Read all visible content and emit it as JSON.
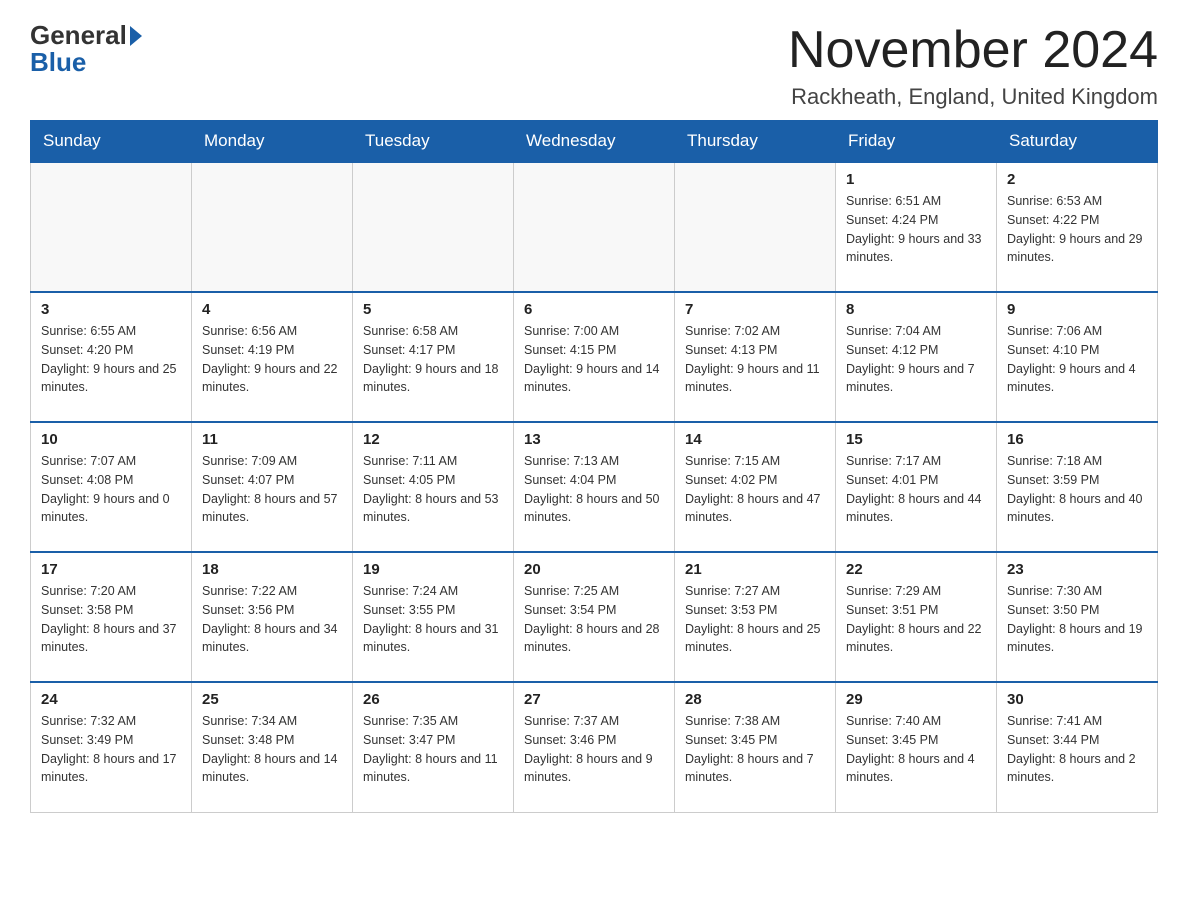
{
  "logo": {
    "general": "General",
    "blue": "Blue"
  },
  "header": {
    "title": "November 2024",
    "location": "Rackheath, England, United Kingdom"
  },
  "days_of_week": [
    "Sunday",
    "Monday",
    "Tuesday",
    "Wednesday",
    "Thursday",
    "Friday",
    "Saturday"
  ],
  "weeks": [
    [
      {
        "day": "",
        "info": ""
      },
      {
        "day": "",
        "info": ""
      },
      {
        "day": "",
        "info": ""
      },
      {
        "day": "",
        "info": ""
      },
      {
        "day": "",
        "info": ""
      },
      {
        "day": "1",
        "info": "Sunrise: 6:51 AM\nSunset: 4:24 PM\nDaylight: 9 hours and 33 minutes."
      },
      {
        "day": "2",
        "info": "Sunrise: 6:53 AM\nSunset: 4:22 PM\nDaylight: 9 hours and 29 minutes."
      }
    ],
    [
      {
        "day": "3",
        "info": "Sunrise: 6:55 AM\nSunset: 4:20 PM\nDaylight: 9 hours and 25 minutes."
      },
      {
        "day": "4",
        "info": "Sunrise: 6:56 AM\nSunset: 4:19 PM\nDaylight: 9 hours and 22 minutes."
      },
      {
        "day": "5",
        "info": "Sunrise: 6:58 AM\nSunset: 4:17 PM\nDaylight: 9 hours and 18 minutes."
      },
      {
        "day": "6",
        "info": "Sunrise: 7:00 AM\nSunset: 4:15 PM\nDaylight: 9 hours and 14 minutes."
      },
      {
        "day": "7",
        "info": "Sunrise: 7:02 AM\nSunset: 4:13 PM\nDaylight: 9 hours and 11 minutes."
      },
      {
        "day": "8",
        "info": "Sunrise: 7:04 AM\nSunset: 4:12 PM\nDaylight: 9 hours and 7 minutes."
      },
      {
        "day": "9",
        "info": "Sunrise: 7:06 AM\nSunset: 4:10 PM\nDaylight: 9 hours and 4 minutes."
      }
    ],
    [
      {
        "day": "10",
        "info": "Sunrise: 7:07 AM\nSunset: 4:08 PM\nDaylight: 9 hours and 0 minutes."
      },
      {
        "day": "11",
        "info": "Sunrise: 7:09 AM\nSunset: 4:07 PM\nDaylight: 8 hours and 57 minutes."
      },
      {
        "day": "12",
        "info": "Sunrise: 7:11 AM\nSunset: 4:05 PM\nDaylight: 8 hours and 53 minutes."
      },
      {
        "day": "13",
        "info": "Sunrise: 7:13 AM\nSunset: 4:04 PM\nDaylight: 8 hours and 50 minutes."
      },
      {
        "day": "14",
        "info": "Sunrise: 7:15 AM\nSunset: 4:02 PM\nDaylight: 8 hours and 47 minutes."
      },
      {
        "day": "15",
        "info": "Sunrise: 7:17 AM\nSunset: 4:01 PM\nDaylight: 8 hours and 44 minutes."
      },
      {
        "day": "16",
        "info": "Sunrise: 7:18 AM\nSunset: 3:59 PM\nDaylight: 8 hours and 40 minutes."
      }
    ],
    [
      {
        "day": "17",
        "info": "Sunrise: 7:20 AM\nSunset: 3:58 PM\nDaylight: 8 hours and 37 minutes."
      },
      {
        "day": "18",
        "info": "Sunrise: 7:22 AM\nSunset: 3:56 PM\nDaylight: 8 hours and 34 minutes."
      },
      {
        "day": "19",
        "info": "Sunrise: 7:24 AM\nSunset: 3:55 PM\nDaylight: 8 hours and 31 minutes."
      },
      {
        "day": "20",
        "info": "Sunrise: 7:25 AM\nSunset: 3:54 PM\nDaylight: 8 hours and 28 minutes."
      },
      {
        "day": "21",
        "info": "Sunrise: 7:27 AM\nSunset: 3:53 PM\nDaylight: 8 hours and 25 minutes."
      },
      {
        "day": "22",
        "info": "Sunrise: 7:29 AM\nSunset: 3:51 PM\nDaylight: 8 hours and 22 minutes."
      },
      {
        "day": "23",
        "info": "Sunrise: 7:30 AM\nSunset: 3:50 PM\nDaylight: 8 hours and 19 minutes."
      }
    ],
    [
      {
        "day": "24",
        "info": "Sunrise: 7:32 AM\nSunset: 3:49 PM\nDaylight: 8 hours and 17 minutes."
      },
      {
        "day": "25",
        "info": "Sunrise: 7:34 AM\nSunset: 3:48 PM\nDaylight: 8 hours and 14 minutes."
      },
      {
        "day": "26",
        "info": "Sunrise: 7:35 AM\nSunset: 3:47 PM\nDaylight: 8 hours and 11 minutes."
      },
      {
        "day": "27",
        "info": "Sunrise: 7:37 AM\nSunset: 3:46 PM\nDaylight: 8 hours and 9 minutes."
      },
      {
        "day": "28",
        "info": "Sunrise: 7:38 AM\nSunset: 3:45 PM\nDaylight: 8 hours and 7 minutes."
      },
      {
        "day": "29",
        "info": "Sunrise: 7:40 AM\nSunset: 3:45 PM\nDaylight: 8 hours and 4 minutes."
      },
      {
        "day": "30",
        "info": "Sunrise: 7:41 AM\nSunset: 3:44 PM\nDaylight: 8 hours and 2 minutes."
      }
    ]
  ]
}
